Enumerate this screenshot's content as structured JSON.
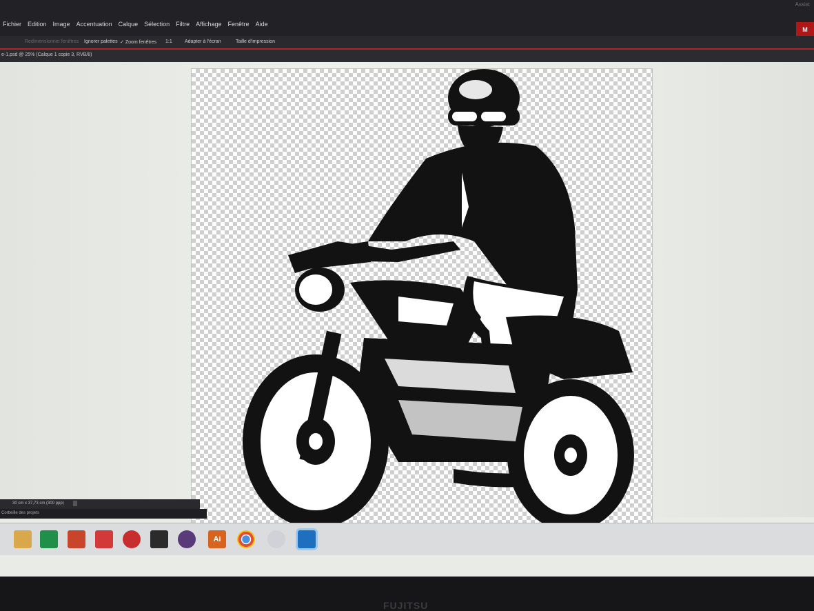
{
  "menubar": {
    "top_right_text": "Assist",
    "items": [
      "Fichier",
      "Edition",
      "Image",
      "Accentuation",
      "Calque",
      "Sélection",
      "Filtre",
      "Affichage",
      "Fenêtre",
      "Aide"
    ],
    "red_button_label": "M"
  },
  "options": {
    "redimensionner": "Redimensionner fenêtres",
    "ignorer": "Ignorer palettes",
    "check": "✓",
    "zoom": "Zoom fenêtres",
    "ratio": "1:1",
    "adapter": "Adapter à l'écran",
    "taille": "Taille d'impression"
  },
  "document": {
    "tab_title": "e-1.psd @ 25% (Calque 1 copie 3, RVB/8)",
    "status_size": "30 cm x 37,73 cm (300 ppp)",
    "project_bin": "Corbeille des projets"
  },
  "taskbar": {
    "icons": [
      {
        "icon": "file-explorer-icon",
        "color": "#d9a84a"
      },
      {
        "icon": "excel-icon",
        "color": "#1f8f4a"
      },
      {
        "icon": "powerpoint-icon",
        "color": "#c8452c"
      },
      {
        "icon": "media-player-icon",
        "color": "#d23a3a"
      },
      {
        "icon": "tools-icon",
        "color": "#c92e2e"
      },
      {
        "icon": "photo-app-icon",
        "color": "#2b2b2b"
      },
      {
        "icon": "camera-raw-icon",
        "color": "#5a3b7a"
      },
      {
        "icon": "illustrator-icon",
        "color": "#d8631e",
        "label": "Ai"
      },
      {
        "icon": "chrome-icon",
        "color": "#e9e9e9"
      },
      {
        "icon": "paint-icon",
        "color": "#cfd3d8"
      },
      {
        "icon": "camera-icon",
        "color": "#1f6fbf",
        "active": true
      }
    ]
  },
  "bezel": {
    "brand": "FUJITSU"
  }
}
